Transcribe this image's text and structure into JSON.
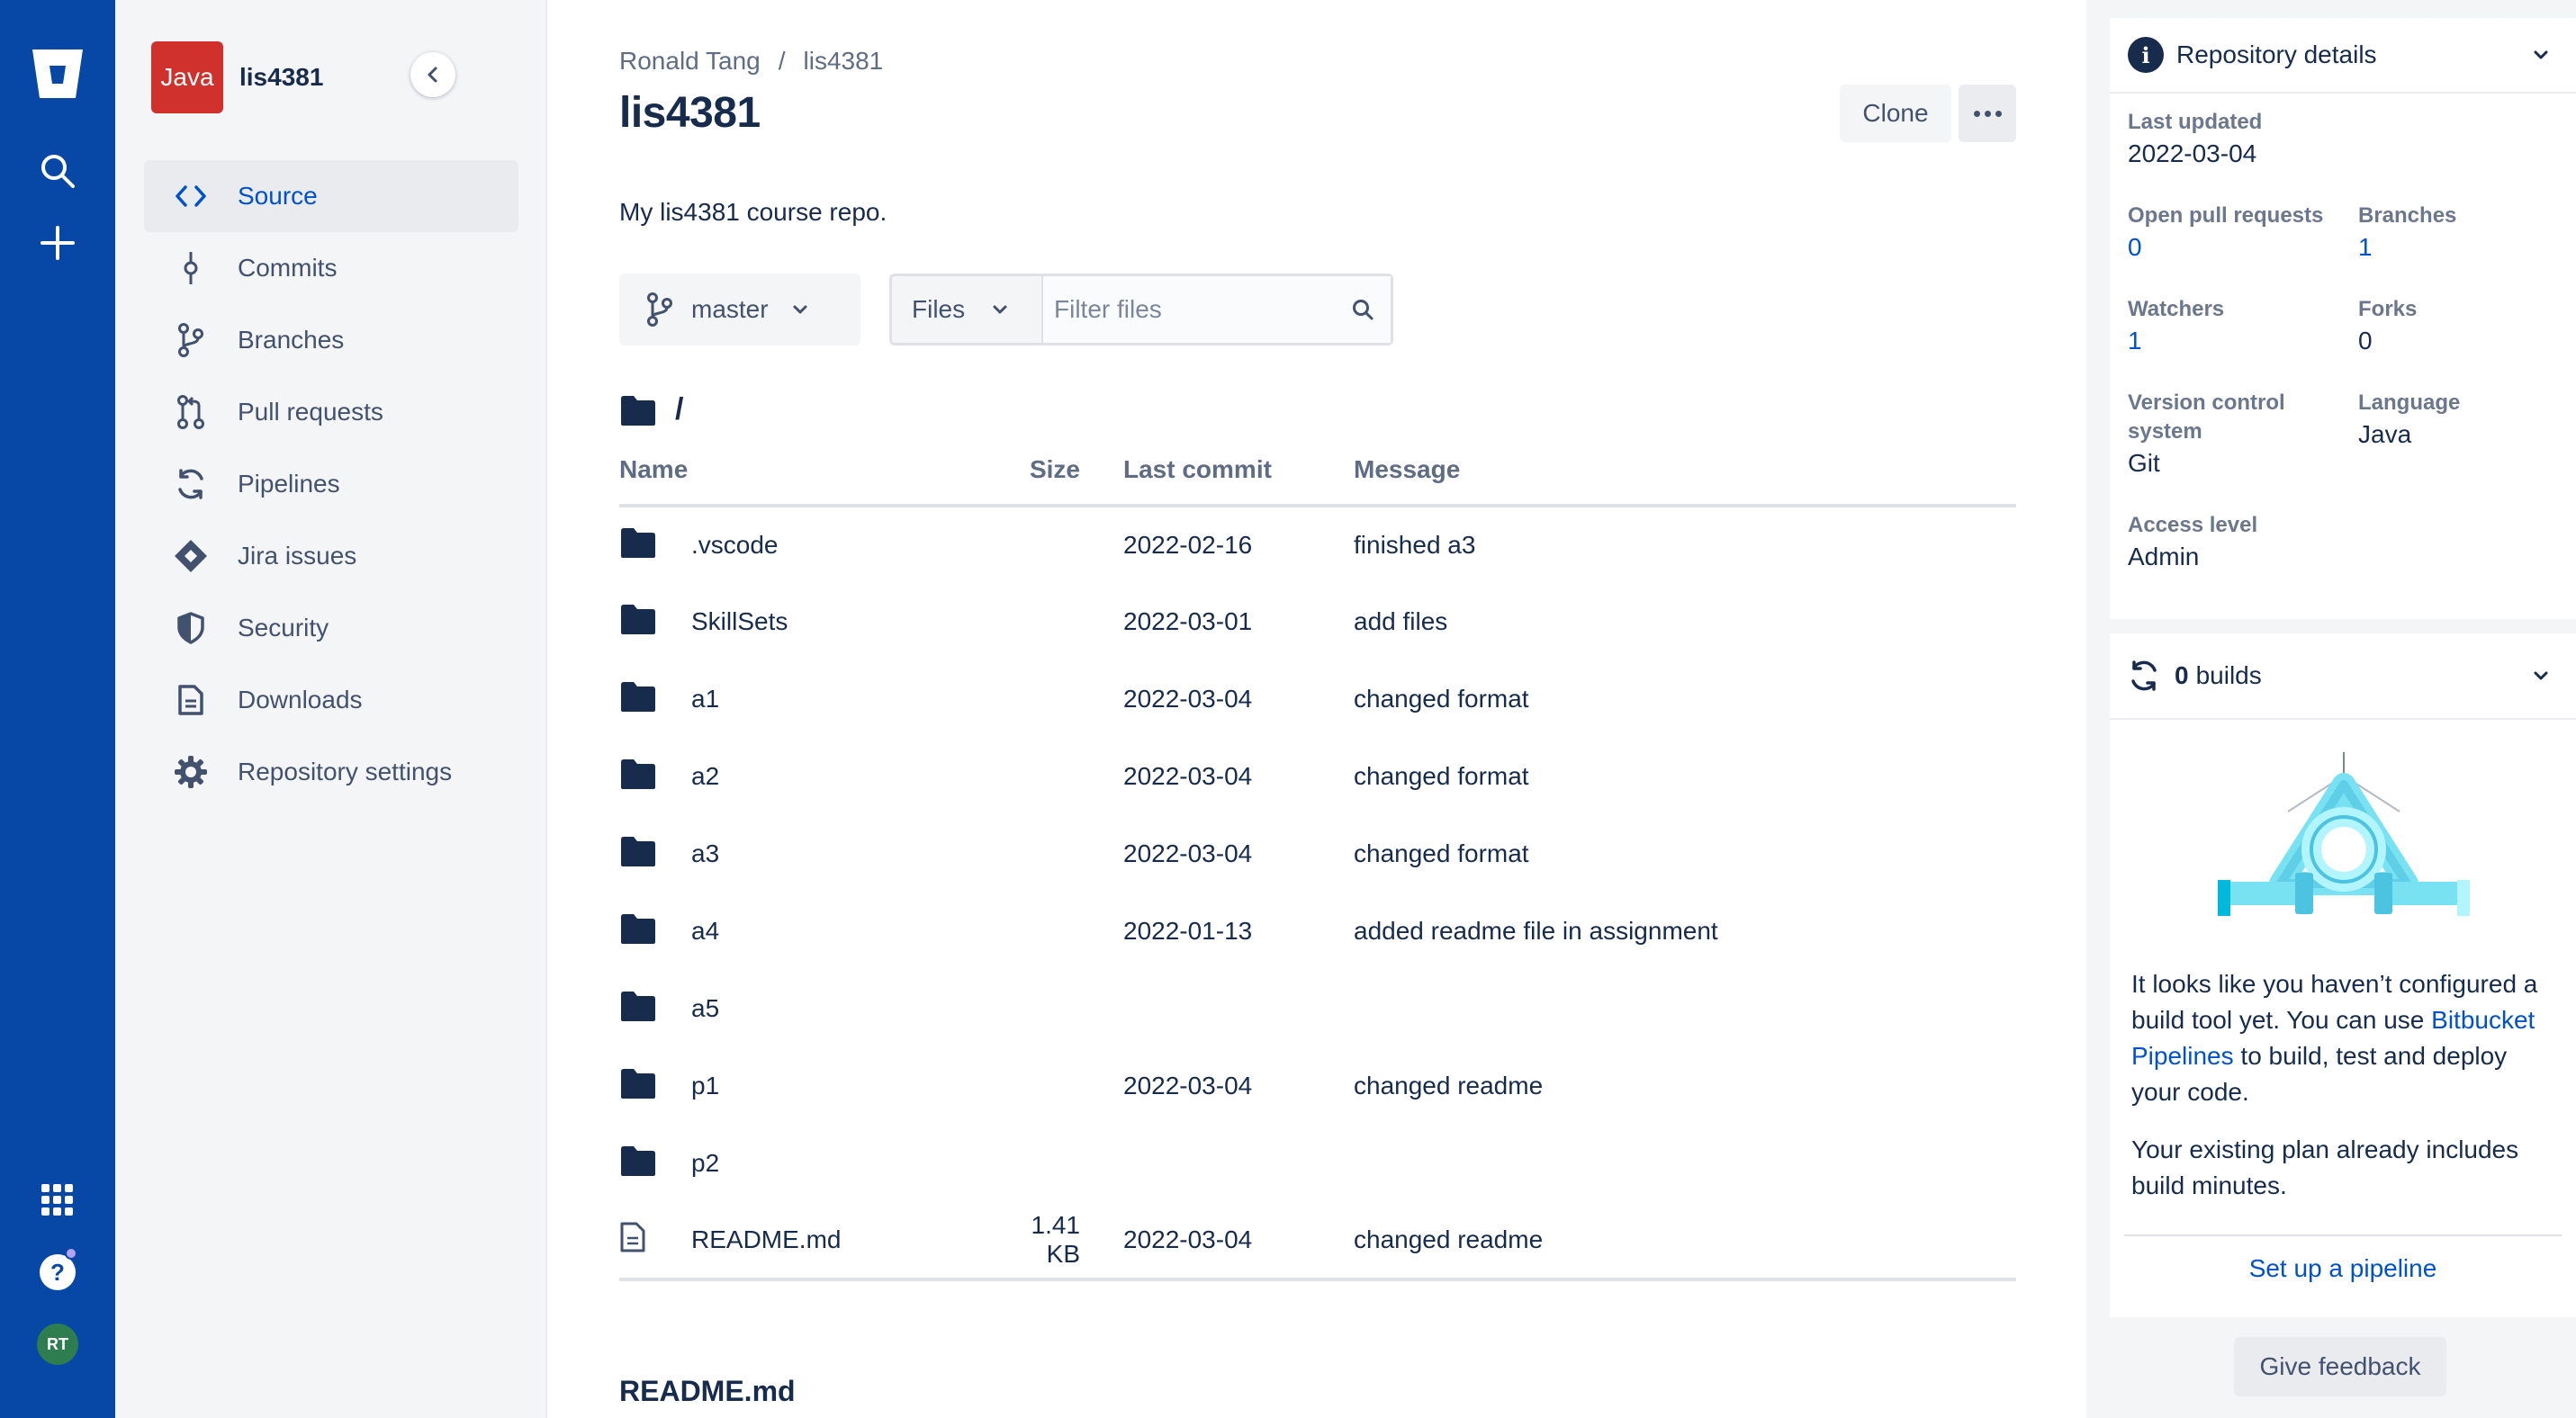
{
  "global_nav": {
    "avatar_initials": "RT"
  },
  "sidebar": {
    "repo_language_badge": "Java",
    "repo_name": "lis4381",
    "items": [
      {
        "label": "Source",
        "icon": "code-icon",
        "active": true
      },
      {
        "label": "Commits",
        "icon": "commit-icon"
      },
      {
        "label": "Branches",
        "icon": "branch-icon"
      },
      {
        "label": "Pull requests",
        "icon": "pull-request-icon"
      },
      {
        "label": "Pipelines",
        "icon": "pipelines-icon"
      },
      {
        "label": "Jira issues",
        "icon": "jira-icon"
      },
      {
        "label": "Security",
        "icon": "shield-icon"
      },
      {
        "label": "Downloads",
        "icon": "document-icon"
      },
      {
        "label": "Repository settings",
        "icon": "gear-icon"
      }
    ]
  },
  "main": {
    "breadcrumb": {
      "owner": "Ronald Tang",
      "separator": "/",
      "repo": "lis4381"
    },
    "title": "lis4381",
    "clone_label": "Clone",
    "description": "My lis4381 course repo.",
    "branch": "master",
    "files_dropdown": "Files",
    "filter_placeholder": "Filter files",
    "path": "/",
    "table": {
      "headers": {
        "name": "Name",
        "size": "Size",
        "last_commit": "Last commit",
        "message": "Message"
      },
      "rows": [
        {
          "type": "folder",
          "name": ".vscode",
          "size": "",
          "last_commit": "2022-02-16",
          "message": "finished a3"
        },
        {
          "type": "folder",
          "name": "SkillSets",
          "size": "",
          "last_commit": "2022-03-01",
          "message": "add files"
        },
        {
          "type": "folder",
          "name": "a1",
          "size": "",
          "last_commit": "2022-03-04",
          "message": "changed format"
        },
        {
          "type": "folder",
          "name": "a2",
          "size": "",
          "last_commit": "2022-03-04",
          "message": "changed format"
        },
        {
          "type": "folder",
          "name": "a3",
          "size": "",
          "last_commit": "2022-03-04",
          "message": "changed format"
        },
        {
          "type": "folder",
          "name": "a4",
          "size": "",
          "last_commit": "2022-01-13",
          "message": "added readme file in assignment"
        },
        {
          "type": "folder",
          "name": "a5",
          "size": "",
          "last_commit": "",
          "message": ""
        },
        {
          "type": "folder",
          "name": "p1",
          "size": "",
          "last_commit": "2022-03-04",
          "message": "changed readme"
        },
        {
          "type": "folder",
          "name": "p2",
          "size": "",
          "last_commit": "",
          "message": ""
        },
        {
          "type": "file",
          "name": "README.md",
          "size": "1.41 KB",
          "last_commit": "2022-03-04",
          "message": "changed readme"
        }
      ]
    },
    "readme_title": "README.md"
  },
  "details": {
    "title": "Repository details",
    "last_updated_label": "Last updated",
    "last_updated": "2022-03-04",
    "open_prs_label": "Open pull requests",
    "open_prs": "0",
    "branches_label": "Branches",
    "branches": "1",
    "watchers_label": "Watchers",
    "watchers": "1",
    "forks_label": "Forks",
    "forks": "0",
    "vcs_label": "Version control system",
    "vcs": "Git",
    "language_label": "Language",
    "language": "Java",
    "access_label": "Access level",
    "access": "Admin"
  },
  "builds": {
    "count": "0",
    "count_suffix": "builds",
    "text_before_link": "It looks like you haven’t configured a build tool yet. You can use ",
    "link": "Bitbucket Pipelines",
    "text_after_link": " to build, test and deploy your code.",
    "plan_text": "Your existing plan already includes build minutes.",
    "setup_link": "Set up a pipeline"
  },
  "feedback_label": "Give feedback",
  "colors": {
    "global_nav": "#0747a6",
    "link": "#0052cc",
    "text": "#172b4d",
    "repo_badge": "#d0312d"
  }
}
